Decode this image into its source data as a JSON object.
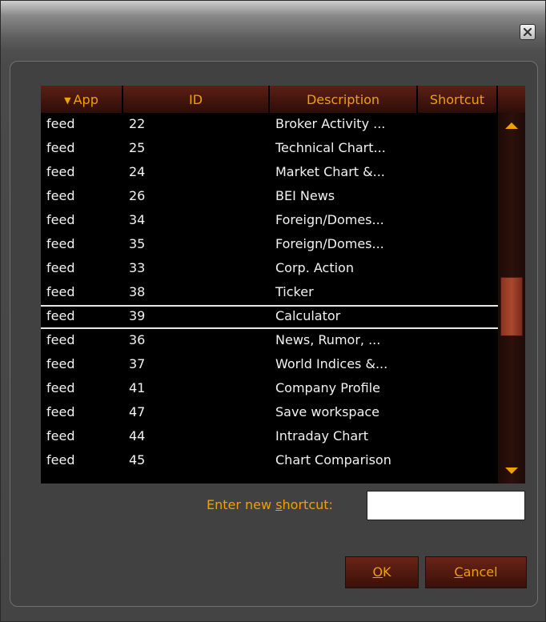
{
  "window": {
    "close_icon": "close-x-icon"
  },
  "table": {
    "columns": [
      {
        "label": "App",
        "sorted": "descending"
      },
      {
        "label": "ID"
      },
      {
        "label": "Description"
      },
      {
        "label": "Shortcut"
      }
    ],
    "rows": [
      {
        "app": "feed",
        "id": "22",
        "description": "Broker Activity ...",
        "shortcut": ""
      },
      {
        "app": "feed",
        "id": "25",
        "description": "Technical Chart...",
        "shortcut": ""
      },
      {
        "app": "feed",
        "id": "24",
        "description": "Market Chart &...",
        "shortcut": ""
      },
      {
        "app": "feed",
        "id": "26",
        "description": "BEI News",
        "shortcut": ""
      },
      {
        "app": "feed",
        "id": "34",
        "description": "Foreign/Domes...",
        "shortcut": ""
      },
      {
        "app": "feed",
        "id": "35",
        "description": "Foreign/Domes...",
        "shortcut": ""
      },
      {
        "app": "feed",
        "id": "33",
        "description": "Corp. Action",
        "shortcut": ""
      },
      {
        "app": "feed",
        "id": "38",
        "description": "Ticker",
        "shortcut": ""
      },
      {
        "app": "feed",
        "id": "39",
        "description": "Calculator",
        "shortcut": "",
        "selected": true
      },
      {
        "app": "feed",
        "id": "36",
        "description": "News, Rumor, ...",
        "shortcut": ""
      },
      {
        "app": "feed",
        "id": "37",
        "description": "World Indices &...",
        "shortcut": ""
      },
      {
        "app": "feed",
        "id": "41",
        "description": "Company Profile",
        "shortcut": ""
      },
      {
        "app": "feed",
        "id": "47",
        "description": "Save workspace",
        "shortcut": ""
      },
      {
        "app": "feed",
        "id": "44",
        "description": "Intraday Chart",
        "shortcut": ""
      },
      {
        "app": "feed",
        "id": "45",
        "description": "Chart Comparison",
        "shortcut": ""
      }
    ]
  },
  "shortcut": {
    "label_before": "Enter new ",
    "label_accel": "s",
    "label_after": "hortcut:",
    "value": ""
  },
  "buttons": {
    "ok_accel": "O",
    "ok_rest": "K",
    "cancel_accel": "C",
    "cancel_rest": "ancel"
  },
  "colors": {
    "accent_text": "#f0a000",
    "header_bg": "#5e1f14",
    "grid_bg": "#000000",
    "scroll_thumb": "#a8492f"
  }
}
